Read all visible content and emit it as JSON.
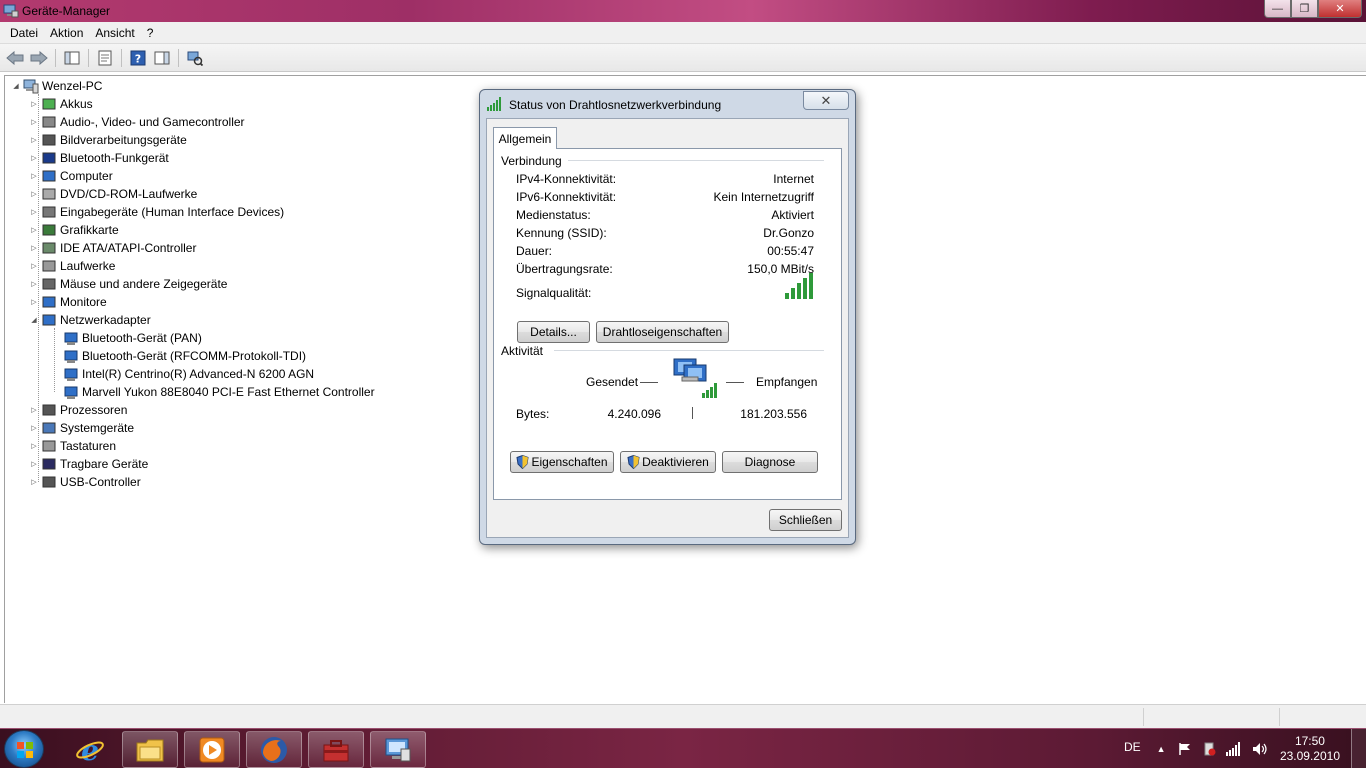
{
  "window": {
    "title": "Geräte-Manager",
    "controls": {
      "minimize": "—",
      "maximize": "❐",
      "close": "✕"
    }
  },
  "menu": {
    "items": [
      "Datei",
      "Aktion",
      "Ansicht",
      "?"
    ]
  },
  "toolbar": {
    "icons": [
      "back-arrow-icon",
      "forward-arrow-icon",
      "console-tree-icon",
      "properties-icon",
      "help-icon",
      "action-pane-icon",
      "scan-hardware-icon"
    ]
  },
  "tree": {
    "root": "Wenzel-PC",
    "categories": [
      {
        "label": "Akkus",
        "icon": "battery-icon",
        "expanded": false
      },
      {
        "label": "Audio-, Video- und Gamecontroller",
        "icon": "speaker-icon",
        "expanded": false
      },
      {
        "label": "Bildverarbeitungsgeräte",
        "icon": "camera-icon",
        "expanded": false
      },
      {
        "label": "Bluetooth-Funkgerät",
        "icon": "bluetooth-icon",
        "expanded": false
      },
      {
        "label": "Computer",
        "icon": "computer-icon",
        "expanded": false
      },
      {
        "label": "DVD/CD-ROM-Laufwerke",
        "icon": "disc-drive-icon",
        "expanded": false
      },
      {
        "label": "Eingabegeräte (Human Interface Devices)",
        "icon": "hid-icon",
        "expanded": false
      },
      {
        "label": "Grafikkarte",
        "icon": "display-adapter-icon",
        "expanded": false
      },
      {
        "label": "IDE ATA/ATAPI-Controller",
        "icon": "ide-controller-icon",
        "expanded": false
      },
      {
        "label": "Laufwerke",
        "icon": "hard-drive-icon",
        "expanded": false
      },
      {
        "label": "Mäuse und andere Zeigegeräte",
        "icon": "mouse-icon",
        "expanded": false
      },
      {
        "label": "Monitore",
        "icon": "monitor-icon",
        "expanded": false
      },
      {
        "label": "Netzwerkadapter",
        "icon": "network-adapter-icon",
        "expanded": true
      },
      {
        "label": "Prozessoren",
        "icon": "processor-icon",
        "expanded": false
      },
      {
        "label": "Systemgeräte",
        "icon": "system-device-icon",
        "expanded": false
      },
      {
        "label": "Tastaturen",
        "icon": "keyboard-icon",
        "expanded": false
      },
      {
        "label": "Tragbare Geräte",
        "icon": "portable-device-icon",
        "expanded": false
      },
      {
        "label": "USB-Controller",
        "icon": "usb-icon",
        "expanded": false
      }
    ],
    "network_children": [
      "Bluetooth-Gerät (PAN)",
      "Bluetooth-Gerät (RFCOMM-Protokoll-TDI)",
      "Intel(R) Centrino(R) Advanced-N 6200 AGN",
      "Marvell Yukon 88E8040 PCI-E Fast Ethernet Controller"
    ]
  },
  "dialog": {
    "title": "Status von Drahtlosnetzwerkverbindung",
    "close_glyph": "✕",
    "tab": "Allgemein",
    "connection": {
      "heading": "Verbindung",
      "rows": [
        {
          "label": "IPv4-Konnektivität:",
          "value": "Internet"
        },
        {
          "label": "IPv6-Konnektivität:",
          "value": "Kein Internetzugriff"
        },
        {
          "label": "Medienstatus:",
          "value": "Aktiviert"
        },
        {
          "label": "Kennung (SSID):",
          "value": "Dr.Gonzo"
        },
        {
          "label": "Dauer:",
          "value": "00:55:47"
        },
        {
          "label": "Übertragungsrate:",
          "value": "150,0 MBit/s"
        }
      ],
      "signal_label": "Signalqualität:",
      "signal_bars_lit": 5,
      "signal_bars_total": 5,
      "details_button": "Details...",
      "wireless_props_button": "Drahtloseigenschaften"
    },
    "activity": {
      "heading": "Aktivität",
      "sent_label": "Gesendet",
      "received_label": "Empfangen",
      "bytes_label": "Bytes:",
      "bytes_sent": "4.240.096",
      "bytes_received": "181.203.556"
    },
    "buttons": {
      "properties": "Eigenschaften",
      "disable": "Deaktivieren",
      "diagnose": "Diagnose",
      "close": "Schließen"
    }
  },
  "taskbar": {
    "pinned": [
      "internet-explorer-icon",
      "explorer-folder-icon",
      "media-player-icon",
      "firefox-icon",
      "toolbox-icon",
      "device-manager-icon"
    ],
    "tray": {
      "language": "DE",
      "time": "17:50",
      "date": "23.09.2010"
    }
  },
  "colors": {
    "signal_green": "#2e9a3a",
    "dialog_frame": "#cfd9e6",
    "taskbar": "#5a1a30"
  }
}
